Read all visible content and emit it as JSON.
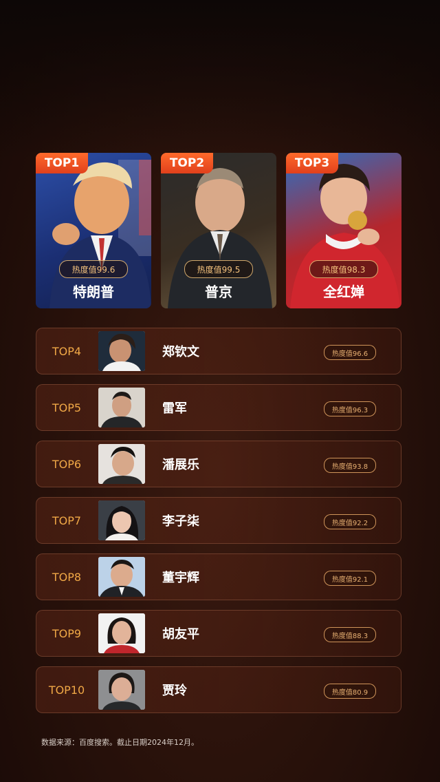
{
  "top3": [
    {
      "rank": "TOP1",
      "name": "特朗普",
      "heat": "热度值99.6"
    },
    {
      "rank": "TOP2",
      "name": "普京",
      "heat": "热度值99.5"
    },
    {
      "rank": "TOP3",
      "name": "全红婵",
      "heat": "热度值98.3"
    }
  ],
  "ranking": [
    {
      "rank": "TOP4",
      "name": "郑钦文",
      "heat": "热度值96.6"
    },
    {
      "rank": "TOP5",
      "name": "雷军",
      "heat": "热度值96.3"
    },
    {
      "rank": "TOP6",
      "name": "潘展乐",
      "heat": "热度值93.8"
    },
    {
      "rank": "TOP7",
      "name": "李子柒",
      "heat": "热度值92.2"
    },
    {
      "rank": "TOP8",
      "name": "董宇辉",
      "heat": "热度值92.1"
    },
    {
      "rank": "TOP9",
      "name": "胡友平",
      "heat": "热度值88.3"
    },
    {
      "rank": "TOP10",
      "name": "贾玲",
      "heat": "热度值80.9"
    }
  ],
  "footer": {
    "source_note": "数据来源：百度搜索。截止日期2024年12月。"
  },
  "colors": {
    "accent_orange": "#e0401c",
    "gold_text": "#f0a846",
    "pill_border": "#e2a464"
  },
  "icons": {
    "portrait": "person-photo",
    "avatar": "person-photo"
  }
}
